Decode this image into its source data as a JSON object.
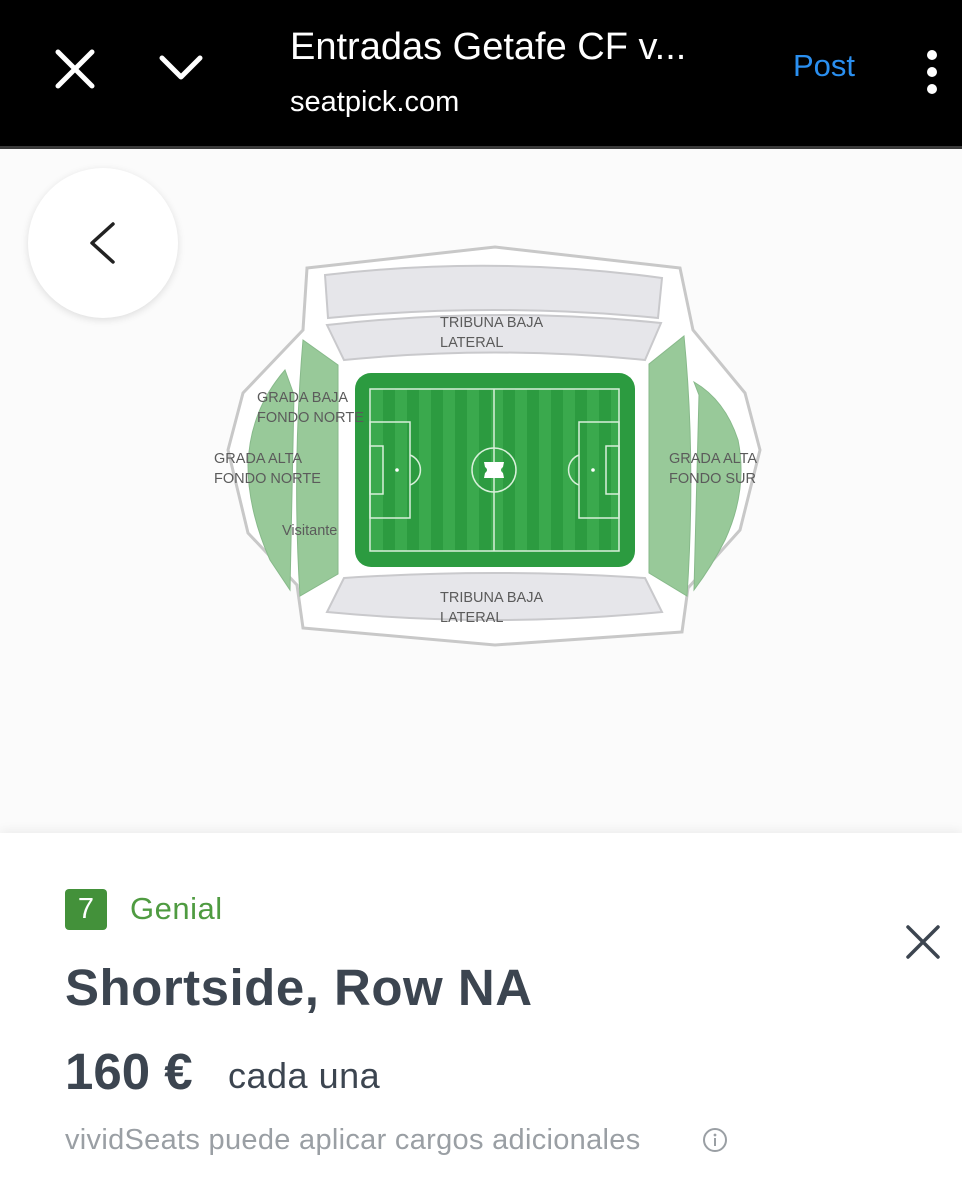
{
  "header": {
    "title": "Entradas Getafe CF v...",
    "domain": "seatpick.com",
    "post_label": "Post",
    "icons": [
      "close-icon",
      "chevron-down-icon",
      "more-vertical-icon"
    ]
  },
  "map": {
    "back_icon": "chevron-left-icon",
    "sections": {
      "tribuna_top_1": "TRIBUNA BAJA",
      "tribuna_top_2": "LATERAL",
      "tribuna_bottom_1": "TRIBUNA BAJA",
      "tribuna_bottom_2": "LATERAL",
      "grada_baja_norte_1": "GRADA BAJA",
      "grada_baja_norte_2": "FONDO NORTE",
      "grada_alta_norte_1": "GRADA ALTA",
      "grada_alta_norte_2": "FONDO NORTE",
      "visitante": "Visitante",
      "grada_alta_sur_1": "GRADA ALTA",
      "grada_alta_sur_2": "FONDO SUR"
    },
    "colors": {
      "highlight": "#98c999",
      "inactive": "#e6e6ea",
      "pitch": "#2c9b40"
    }
  },
  "listing": {
    "score": "7",
    "rating_label": "Genial",
    "seat": "Shortside, Row NA",
    "price": "160 €",
    "price_unit": "cada una",
    "fees_note": "vividSeats puede aplicar cargos adicionales",
    "accent": "#43913a"
  }
}
